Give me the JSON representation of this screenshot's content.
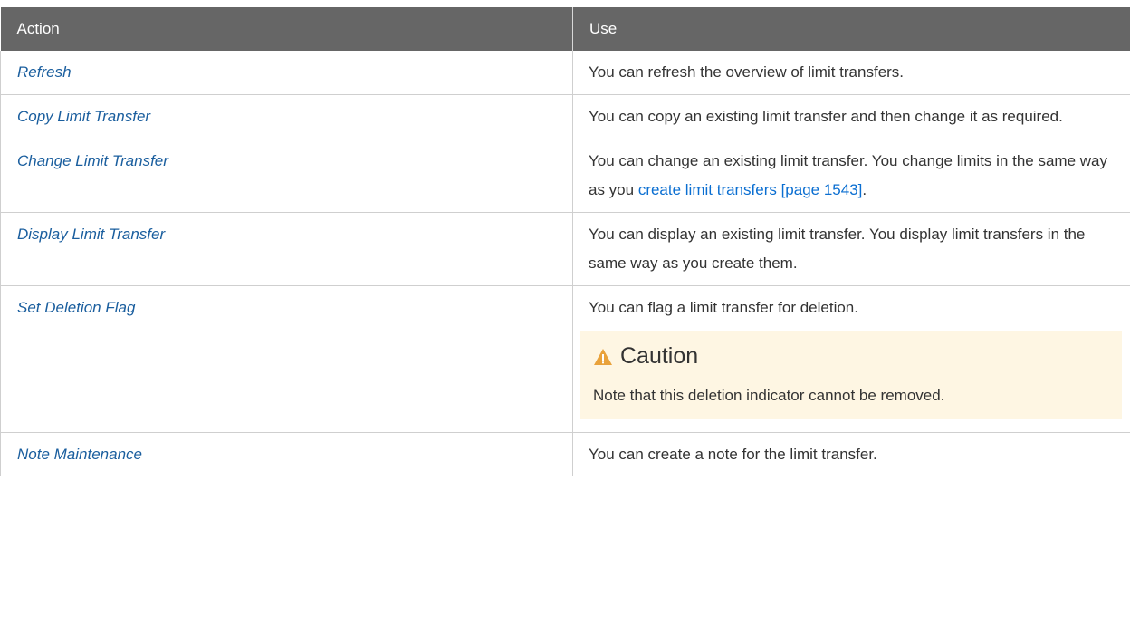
{
  "table": {
    "headers": [
      "Action",
      "Use"
    ],
    "rows": [
      {
        "action": "Refresh",
        "use": "You can refresh the overview of limit transfers."
      },
      {
        "action": "Copy Limit Transfer",
        "use": "You can copy an existing limit transfer and then change it as required."
      },
      {
        "action": "Change Limit Transfer",
        "use_prefix": "You can change an existing limit transfer. You change limits in the same way as you ",
        "use_link": "create limit transfers [page 1543]",
        "use_suffix": "."
      },
      {
        "action": "Display Limit Transfer",
        "use": "You can display an existing limit transfer. You display limit transfers in the same way as you create them."
      },
      {
        "action": "Set Deletion Flag",
        "use": "You can flag a limit transfer for deletion.",
        "caution": {
          "title": "Caution",
          "text": "Note that this deletion indicator cannot be removed.",
          "icon": "warning-triangle-icon",
          "icon_color": "#e9a23b",
          "background": "#fef6e3"
        }
      },
      {
        "action": "Note Maintenance",
        "use": "You can create a note for the limit transfer."
      }
    ]
  },
  "colors": {
    "header_bg": "#666666",
    "action_text": "#1a5e9e",
    "link": "#0a6ed1",
    "body_text": "#333333"
  }
}
